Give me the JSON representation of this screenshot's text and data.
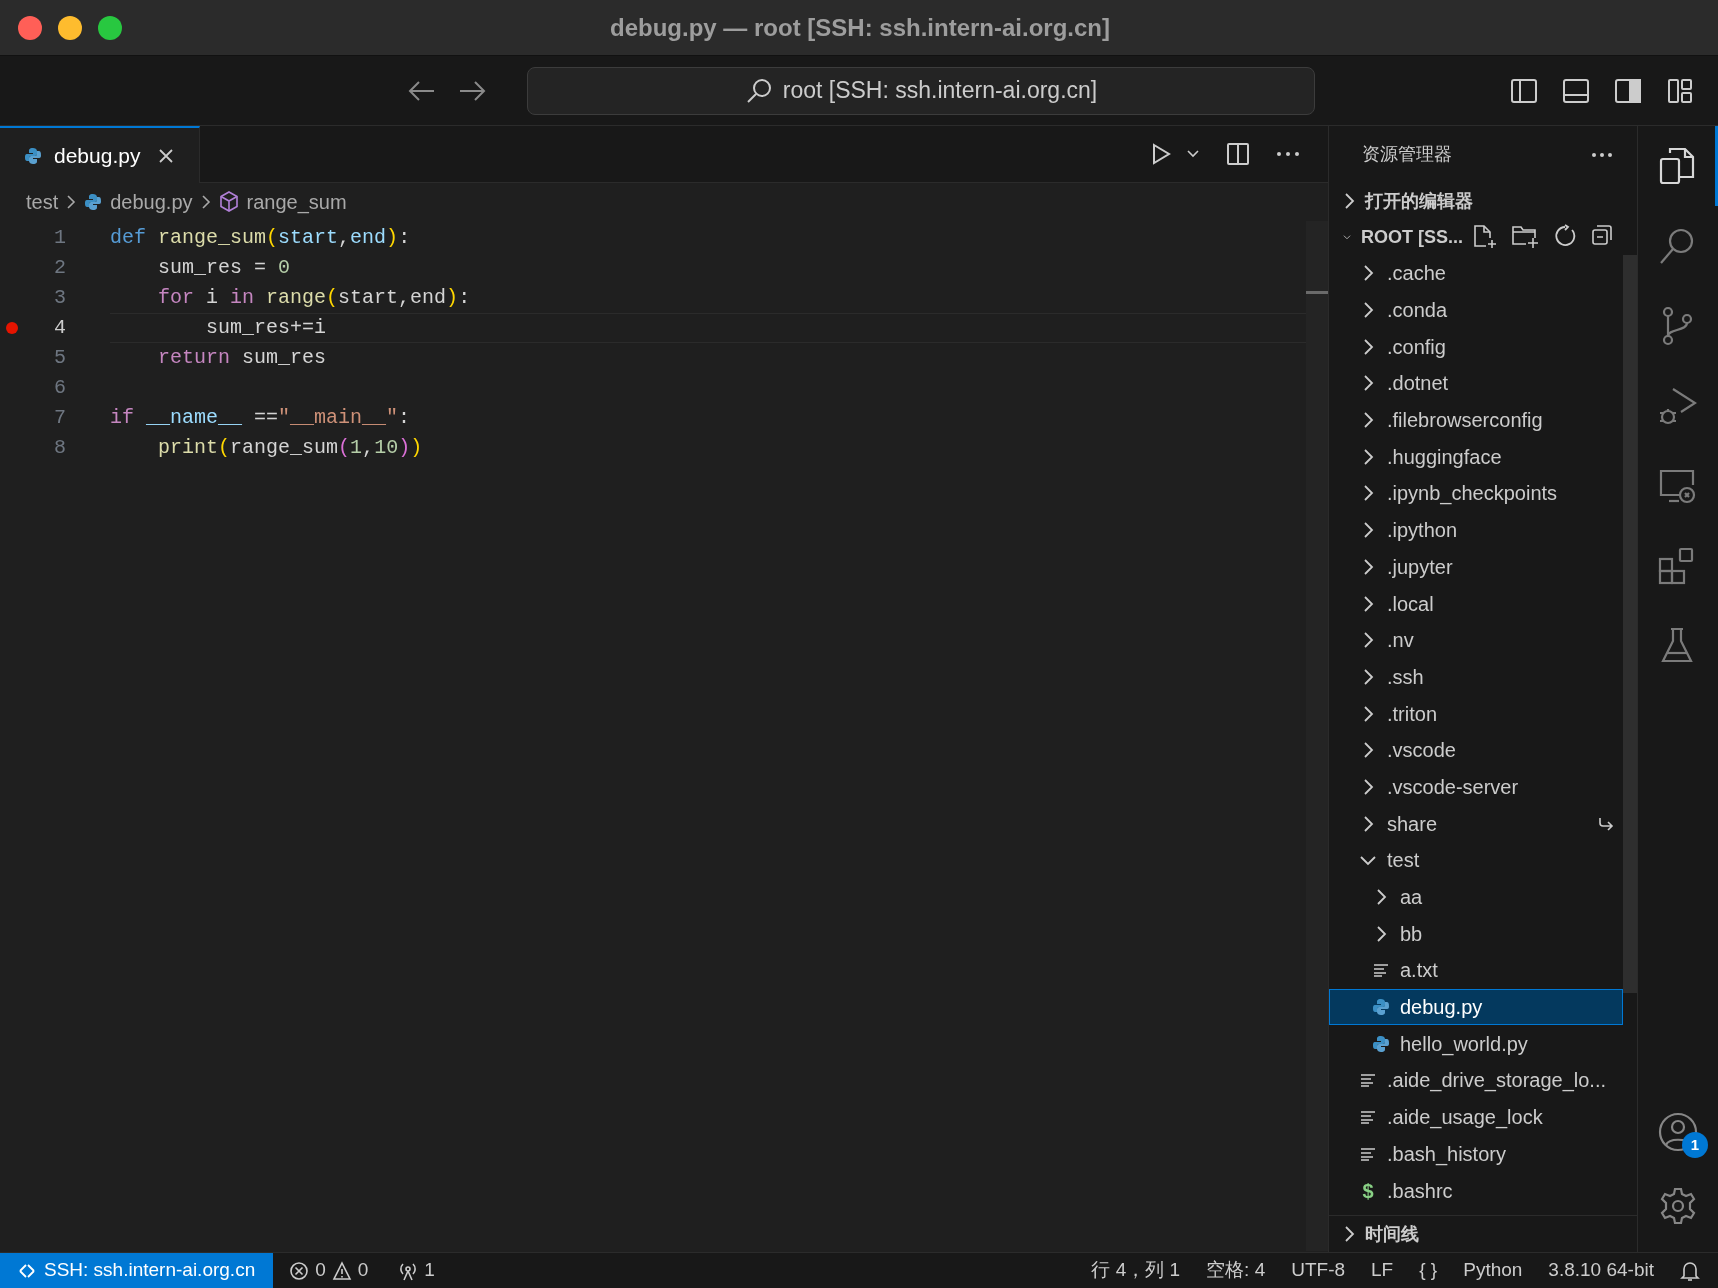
{
  "window": {
    "title": "debug.py — root [SSH: ssh.intern-ai.org.cn]"
  },
  "command_center": {
    "text": "root [SSH: ssh.intern-ai.org.cn]"
  },
  "tabs": [
    {
      "label": "debug.py",
      "selected": true
    }
  ],
  "breadcrumbs": [
    {
      "label": "test",
      "kind": "folder"
    },
    {
      "label": "debug.py",
      "kind": "python"
    },
    {
      "label": "range_sum",
      "kind": "symbol"
    }
  ],
  "code_lines": [
    {
      "number": "1",
      "breakpoint": false,
      "current": false,
      "tokens": [
        {
          "text": "def ",
          "kind": "keyword"
        },
        {
          "text": "range_sum",
          "kind": "function"
        },
        {
          "text": "(",
          "kind": "bracket1"
        },
        {
          "text": "start",
          "kind": "param"
        },
        {
          "text": ",",
          "kind": "plain"
        },
        {
          "text": "end",
          "kind": "param"
        },
        {
          "text": ")",
          "kind": "bracket1"
        },
        {
          "text": ":",
          "kind": "plain"
        }
      ]
    },
    {
      "number": "2",
      "breakpoint": false,
      "current": false,
      "tokens": [
        {
          "text": "    sum_res = ",
          "kind": "plain"
        },
        {
          "text": "0",
          "kind": "number"
        }
      ]
    },
    {
      "number": "3",
      "breakpoint": false,
      "current": false,
      "tokens": [
        {
          "text": "    for",
          "kind": "control"
        },
        {
          "text": " i ",
          "kind": "plain"
        },
        {
          "text": "in ",
          "kind": "control"
        },
        {
          "text": "range",
          "kind": "function"
        },
        {
          "text": "(",
          "kind": "bracket1"
        },
        {
          "text": "start,end",
          "kind": "plain"
        },
        {
          "text": ")",
          "kind": "bracket1"
        },
        {
          "text": ":",
          "kind": "plain"
        }
      ]
    },
    {
      "number": "4",
      "breakpoint": true,
      "current": true,
      "tokens": [
        {
          "text": "        sum_res+=i",
          "kind": "plain"
        }
      ]
    },
    {
      "number": "5",
      "breakpoint": false,
      "current": false,
      "tokens": [
        {
          "text": "    return",
          "kind": "control"
        },
        {
          "text": " sum_res",
          "kind": "plain"
        }
      ]
    },
    {
      "number": "6",
      "breakpoint": false,
      "current": false
    },
    {
      "number": "7",
      "breakpoint": false,
      "current": false,
      "tokens": [
        {
          "text": "if ",
          "kind": "control"
        },
        {
          "text": "__name__",
          "kind": "param"
        },
        {
          "text": " ==",
          "kind": "plain"
        },
        {
          "text": "\"__main__\"",
          "kind": "string"
        },
        {
          "text": ":",
          "kind": "plain"
        }
      ]
    },
    {
      "number": "8",
      "breakpoint": false,
      "current": false,
      "tokens": [
        {
          "text": "    print",
          "kind": "function"
        },
        {
          "text": "(",
          "kind": "bracket1"
        },
        {
          "text": "range_sum",
          "kind": "plain"
        },
        {
          "text": "(",
          "kind": "bracket2"
        },
        {
          "text": "1",
          "kind": "number"
        },
        {
          "text": ",",
          "kind": "plain"
        },
        {
          "text": "10",
          "kind": "number"
        },
        {
          "text": ")",
          "kind": "bracket2"
        },
        {
          "text": ")",
          "kind": "bracket1"
        }
      ]
    }
  ],
  "sidebar": {
    "title": "资源管理器",
    "sections": [
      {
        "label": "打开的编辑器",
        "expanded": false
      },
      {
        "label": "ROOT [SS...",
        "expanded": true
      },
      {
        "label": "时间线",
        "expanded": false
      }
    ],
    "tree": [
      {
        "label": ".cache",
        "kind": "folder",
        "expanded": false,
        "selected": false
      },
      {
        "label": ".conda",
        "kind": "folder",
        "expanded": false,
        "selected": false
      },
      {
        "label": ".config",
        "kind": "folder",
        "expanded": false,
        "selected": false
      },
      {
        "label": ".dotnet",
        "kind": "folder",
        "expanded": false,
        "selected": false
      },
      {
        "label": ".filebrowserconfig",
        "kind": "folder",
        "expanded": false,
        "selected": false
      },
      {
        "label": ".huggingface",
        "kind": "folder",
        "expanded": false,
        "selected": false
      },
      {
        "label": ".ipynb_checkpoints",
        "kind": "folder",
        "expanded": false,
        "selected": false
      },
      {
        "label": ".ipython",
        "kind": "folder",
        "expanded": false,
        "selected": false
      },
      {
        "label": ".jupyter",
        "kind": "folder",
        "expanded": false,
        "selected": false
      },
      {
        "label": ".local",
        "kind": "folder",
        "expanded": false,
        "selected": false
      },
      {
        "label": ".nv",
        "kind": "folder",
        "expanded": false,
        "selected": false
      },
      {
        "label": ".ssh",
        "kind": "folder",
        "expanded": false,
        "selected": false
      },
      {
        "label": ".triton",
        "kind": "folder",
        "expanded": false,
        "selected": false
      },
      {
        "label": ".vscode",
        "kind": "folder",
        "expanded": false,
        "selected": false
      },
      {
        "label": ".vscode-server",
        "kind": "folder",
        "expanded": false,
        "selected": false
      },
      {
        "label": "share",
        "kind": "folder-link",
        "expanded": false,
        "selected": false
      },
      {
        "label": "test",
        "kind": "folder",
        "expanded": true,
        "selected": false,
        "children": [
          {
            "label": "aa",
            "kind": "folder",
            "expanded": false,
            "selected": false
          },
          {
            "label": "bb",
            "kind": "folder",
            "expanded": false,
            "selected": false
          },
          {
            "label": "a.txt",
            "kind": "text",
            "selected": false
          },
          {
            "label": "debug.py",
            "kind": "python",
            "selected": true
          },
          {
            "label": "hello_world.py",
            "kind": "python",
            "selected": false
          }
        ]
      },
      {
        "label": ".aide_drive_storage_lo...",
        "kind": "text",
        "selected": false
      },
      {
        "label": ".aide_usage_lock",
        "kind": "text",
        "selected": false
      },
      {
        "label": ".bash_history",
        "kind": "text",
        "selected": false
      },
      {
        "label": ".bashrc",
        "kind": "shell",
        "icon": "$",
        "selected": false
      }
    ]
  },
  "activity_bar": [
    {
      "kind": "explorer",
      "selected": true
    },
    {
      "kind": "search",
      "selected": false
    },
    {
      "kind": "source-control",
      "selected": false
    },
    {
      "kind": "run-debug",
      "selected": false
    },
    {
      "kind": "remote",
      "selected": false
    },
    {
      "kind": "extensions",
      "selected": false
    },
    {
      "kind": "testing",
      "selected": false
    }
  ],
  "account_badge": "1",
  "status_bar": {
    "remote": "SSH: ssh.intern-ai.org.cn",
    "errors": "0",
    "warnings": "0",
    "ports": "1",
    "right": [
      {
        "text": "行 4，列 1"
      },
      {
        "text": "空格: 4"
      },
      {
        "text": "UTF-8"
      },
      {
        "text": "LF"
      },
      {
        "text": "{ }"
      },
      {
        "text": "Python"
      },
      {
        "text": "3.8.10 64-bit"
      }
    ]
  }
}
